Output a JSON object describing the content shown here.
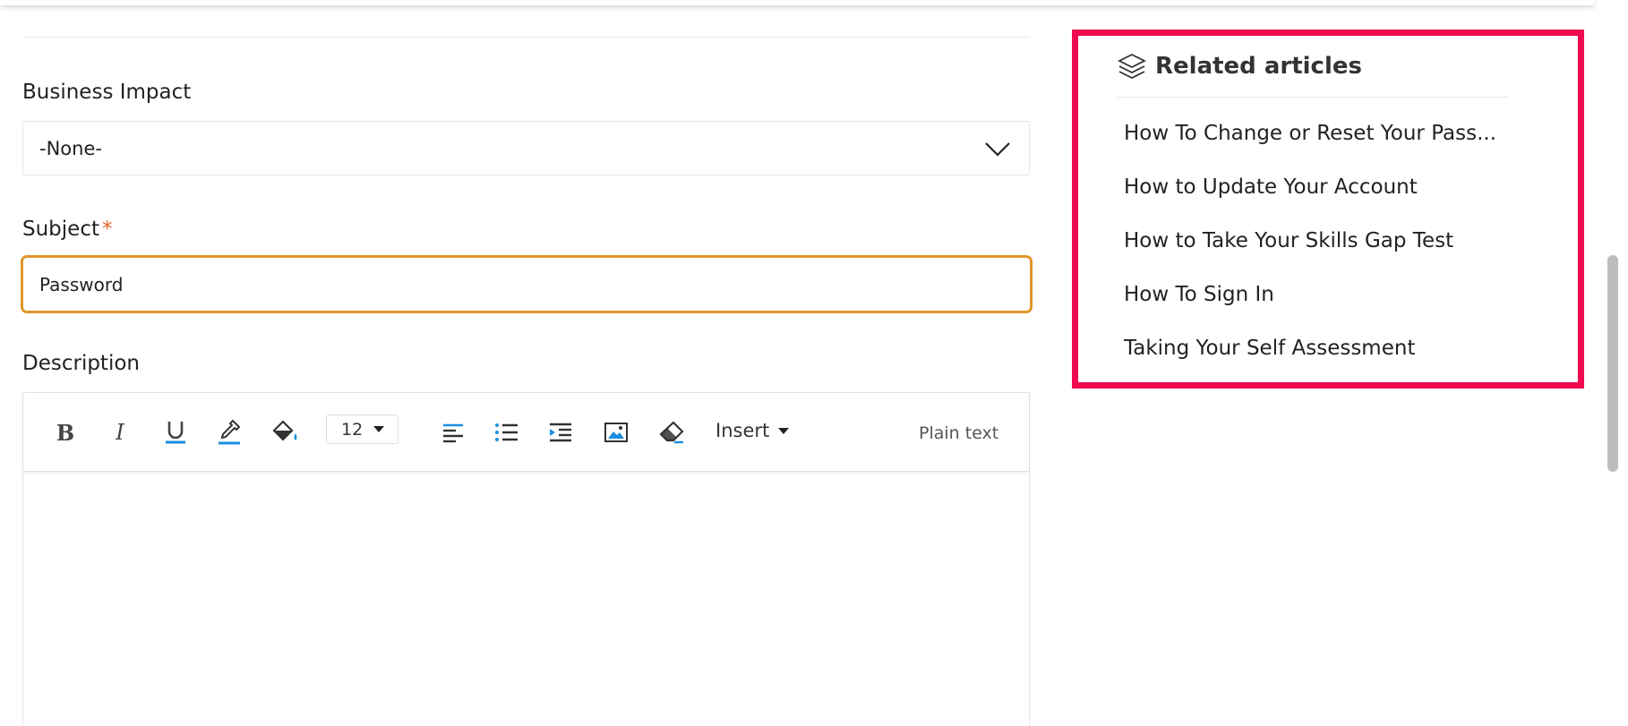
{
  "form": {
    "business_impact": {
      "label": "Business Impact",
      "value": "-None-"
    },
    "subject": {
      "label": "Subject",
      "required_mark": "*",
      "value": "Password"
    },
    "description": {
      "label": "Description",
      "toolbar": {
        "bold": "B",
        "italic": "I",
        "underline": "U",
        "font_size": "12",
        "insert_label": "Insert",
        "plain_text_label": "Plain text"
      }
    }
  },
  "related": {
    "title": "Related articles",
    "articles": [
      "How To Change or Reset Your Pass...",
      "How to Update Your Account",
      "How to Take Your Skills Gap Test",
      "How To Sign In",
      "Taking Your Self Assessment"
    ]
  },
  "colors": {
    "highlight_border": "#f0094f",
    "focus_border": "#e0962a",
    "required": "#e0622a",
    "icon_blue": "#1a8fe0"
  }
}
